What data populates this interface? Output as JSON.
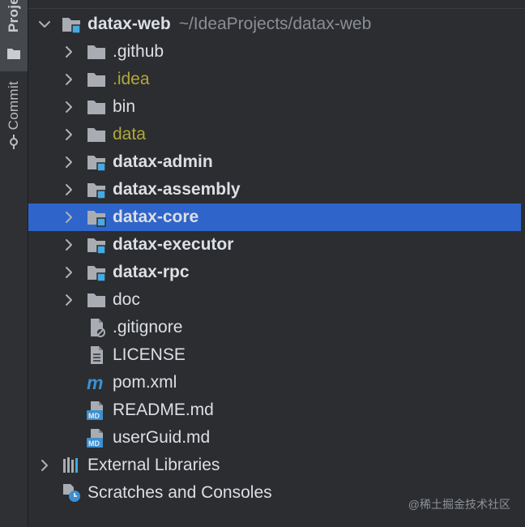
{
  "sidebar": {
    "project_tab": "Proje",
    "commit_tab": "Commit"
  },
  "tree": {
    "root": {
      "name": "datax-web",
      "path": "~/IdeaProjects/datax-web"
    },
    "items": [
      {
        "name": ".github",
        "kind": "folder",
        "bold": false,
        "excluded": false,
        "expandable": true
      },
      {
        "name": ".idea",
        "kind": "folder",
        "bold": false,
        "excluded": true,
        "expandable": true
      },
      {
        "name": "bin",
        "kind": "folder",
        "bold": false,
        "excluded": false,
        "expandable": true
      },
      {
        "name": "data",
        "kind": "folder",
        "bold": false,
        "excluded": true,
        "expandable": true
      },
      {
        "name": "datax-admin",
        "kind": "module",
        "bold": true,
        "excluded": false,
        "expandable": true
      },
      {
        "name": "datax-assembly",
        "kind": "module",
        "bold": true,
        "excluded": false,
        "expandable": true
      },
      {
        "name": "datax-core",
        "kind": "module",
        "bold": true,
        "excluded": false,
        "expandable": true,
        "selected": true
      },
      {
        "name": "datax-executor",
        "kind": "module",
        "bold": true,
        "excluded": false,
        "expandable": true
      },
      {
        "name": "datax-rpc",
        "kind": "module",
        "bold": true,
        "excluded": false,
        "expandable": true
      },
      {
        "name": "doc",
        "kind": "folder",
        "bold": false,
        "excluded": false,
        "expandable": true
      },
      {
        "name": ".gitignore",
        "kind": "ignore-file",
        "bold": false,
        "excluded": false,
        "expandable": false
      },
      {
        "name": "LICENSE",
        "kind": "text-file",
        "bold": false,
        "excluded": false,
        "expandable": false
      },
      {
        "name": "pom.xml",
        "kind": "maven-file",
        "bold": false,
        "excluded": false,
        "expandable": false
      },
      {
        "name": "README.md",
        "kind": "markdown-file",
        "bold": false,
        "excluded": false,
        "expandable": false
      },
      {
        "name": "userGuid.md",
        "kind": "markdown-file",
        "bold": false,
        "excluded": false,
        "expandable": false
      }
    ],
    "external_libraries": "External Libraries",
    "scratches": "Scratches and Consoles"
  },
  "colors": {
    "selection": "#2f65ca",
    "excluded_text": "#b3a73a",
    "folder": "#a9adb3",
    "module_badge": "#46a9e0"
  },
  "watermark": "@稀土掘金技术社区"
}
